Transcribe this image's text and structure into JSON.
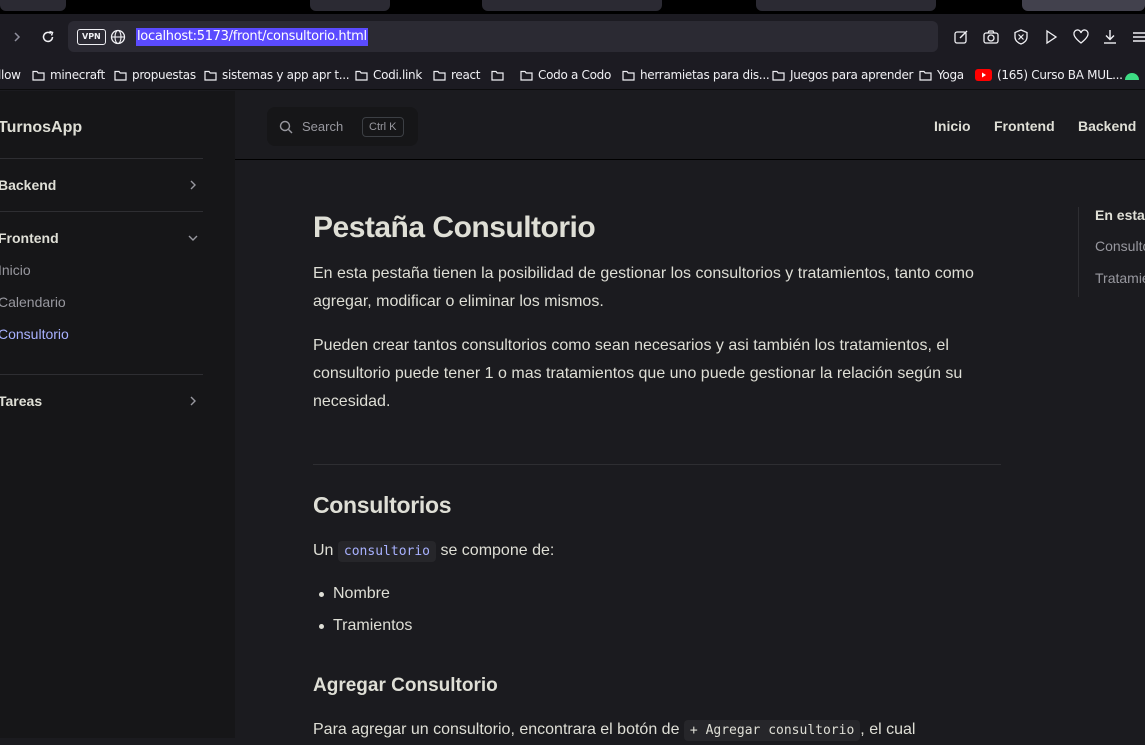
{
  "browser": {
    "url": "localhost:5173/front/consultorio.html",
    "vpn_badge": "VPN",
    "bookmarks": [
      {
        "label": "llow",
        "icon": "folder-icon"
      },
      {
        "label": "minecraft",
        "icon": "folder-icon"
      },
      {
        "label": "propuestas",
        "icon": "folder-icon"
      },
      {
        "label": "sistemas y app apr t...",
        "icon": "folder-icon"
      },
      {
        "label": "Codi.link",
        "icon": "folder-icon"
      },
      {
        "label": "react",
        "icon": "folder-icon"
      },
      {
        "label": "",
        "icon": "folder-icon"
      },
      {
        "label": "Codo a Codo",
        "icon": "folder-icon"
      },
      {
        "label": "herramietas para dis...",
        "icon": "folder-icon"
      },
      {
        "label": "Juegos para aprender",
        "icon": "folder-icon"
      },
      {
        "label": "Yoga",
        "icon": "folder-icon"
      },
      {
        "label": "(165) Curso BA MUL...",
        "icon": "youtube-icon"
      }
    ]
  },
  "site": {
    "brand": "TurnosApp",
    "search_label": "Search",
    "search_shortcut": "Ctrl K",
    "nav": [
      "Inicio",
      "Frontend",
      "Backend"
    ]
  },
  "sidebar": {
    "groups": [
      {
        "label": "Backend",
        "expanded": false
      },
      {
        "label": "Frontend",
        "expanded": true,
        "items": [
          "Inicio",
          "Calendario",
          "Consultorio"
        ],
        "active": "Consultorio"
      },
      {
        "label": "Tareas",
        "expanded": false
      }
    ]
  },
  "article": {
    "title": "Pestaña Consultorio",
    "intro1": "En esta pestaña tienen la posibilidad de gestionar los consultorios y tratamientos, tanto como agregar, modificar o eliminar los mismos.",
    "intro2": "Pueden crear tantos consultorios como sean necesarios y asi también los tratamientos, el consultorio puede tener 1 o mas tratamientos que uno puede gestionar la relación según su necesidad.",
    "section_title": "Consultorios",
    "compose_pre": "Un",
    "compose_code": "consultorio",
    "compose_post": "se compone de:",
    "list": [
      "Nombre",
      "Tramientos"
    ],
    "subsection_title": "Agregar Consultorio",
    "add_pre": "Para agregar un consultorio, encontrara el botón de",
    "add_code": "+ Agregar consultorio",
    "add_post": ", el cual"
  },
  "outline": {
    "title": "En esta página",
    "items": [
      "Consultorios",
      "Tratamientos"
    ]
  }
}
